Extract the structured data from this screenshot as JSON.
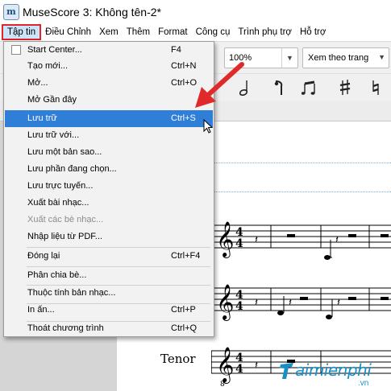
{
  "window": {
    "title": "MuseScore 3: Không tên-2*",
    "app_icon_glyph": "m"
  },
  "menubar": {
    "items": [
      {
        "label": "Tập tin"
      },
      {
        "label": "Điều Chỉnh"
      },
      {
        "label": "Xem"
      },
      {
        "label": "Thêm"
      },
      {
        "label": "Format"
      },
      {
        "label": "Công cụ"
      },
      {
        "label": "Trình phụ trợ"
      },
      {
        "label": "Hỗ trợ"
      }
    ]
  },
  "toolbar": {
    "zoom_value": "100%",
    "view_mode": "Xem theo trang"
  },
  "file_menu": {
    "items": [
      {
        "label": "Start Center...",
        "shortcut": "F4"
      },
      {
        "label": "Tạo mới...",
        "shortcut": "Ctrl+N"
      },
      {
        "label": "Mở...",
        "shortcut": "Ctrl+O"
      },
      {
        "label": "Mở Gần đây",
        "shortcut": ""
      },
      {
        "label": "Lưu trữ",
        "shortcut": "Ctrl+S"
      },
      {
        "label": "Lưu trữ với...",
        "shortcut": ""
      },
      {
        "label": "Lưu một bản sao...",
        "shortcut": ""
      },
      {
        "label": "Lưu phần đang chọn...",
        "shortcut": ""
      },
      {
        "label": "Lưu trực tuyến...",
        "shortcut": ""
      },
      {
        "label": "Xuất bài nhạc...",
        "shortcut": ""
      },
      {
        "label": "Xuất các bè nhạc...",
        "shortcut": ""
      },
      {
        "label": "Nhập liệu từ PDF...",
        "shortcut": ""
      },
      {
        "label": "Đóng lại",
        "shortcut": "Ctrl+F4"
      },
      {
        "label": "Phân chia bè...",
        "shortcut": ""
      },
      {
        "label": "Thuộc tính bản nhạc...",
        "shortcut": ""
      },
      {
        "label": "In ấn...",
        "shortcut": "Ctrl+P"
      },
      {
        "label": "Thoát chương trình",
        "shortcut": "Ctrl+Q"
      }
    ],
    "selected_index": 4,
    "disabled_index": 10
  },
  "score": {
    "staff_label": "Tenor",
    "time_signature": "4/4"
  },
  "watermark": {
    "brand": "aimienphi",
    "suffix": ".vn"
  },
  "colors": {
    "highlight": "#2f7ed8",
    "menu_active_border": "#e0242b",
    "arrow": "#e02a2a",
    "logo": "#1790c9"
  }
}
